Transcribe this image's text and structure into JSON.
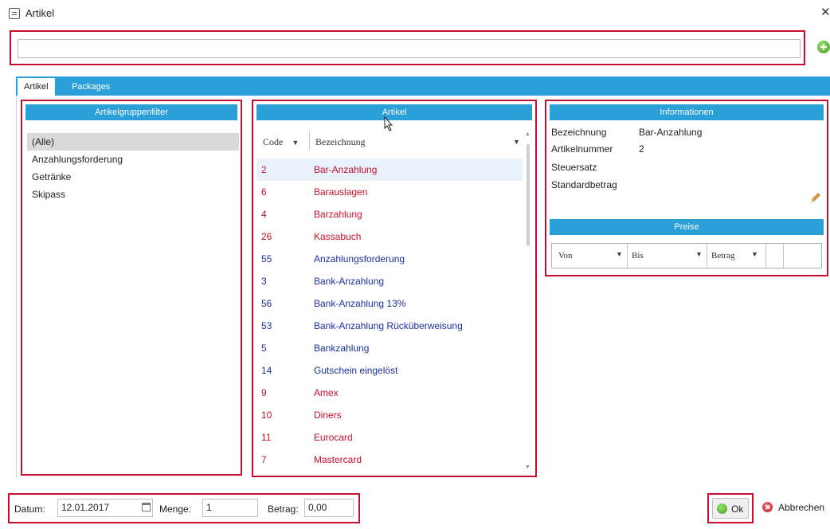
{
  "window": {
    "title": "Artikel",
    "close_symbol": "✕"
  },
  "search": {
    "value": "",
    "placeholder": ""
  },
  "tabs": [
    {
      "label": "Artikel",
      "active": true
    },
    {
      "label": "Packages",
      "active": false
    }
  ],
  "group_panel": {
    "header": "Artikelgruppenfilter",
    "items": [
      {
        "label": "(Alle)",
        "selected": true
      },
      {
        "label": "Anzahlungsforderung",
        "selected": false
      },
      {
        "label": "Getränke",
        "selected": false
      },
      {
        "label": "Skipass",
        "selected": false
      }
    ]
  },
  "artikel_panel": {
    "header": "Artikel",
    "columns": {
      "code": "Code",
      "bezeichnung": "Bezeichnung"
    },
    "rows": [
      {
        "code": "2",
        "bezeichnung": "Bar-Anzahlung",
        "color": "red",
        "selected": true
      },
      {
        "code": "6",
        "bezeichnung": "Barauslagen",
        "color": "red"
      },
      {
        "code": "4",
        "bezeichnung": "Barzahlung",
        "color": "red"
      },
      {
        "code": "26",
        "bezeichnung": "Kassabuch",
        "color": "red"
      },
      {
        "code": "55",
        "bezeichnung": "Anzahlungsforderung",
        "color": "blue"
      },
      {
        "code": "3",
        "bezeichnung": "Bank-Anzahlung",
        "color": "blue"
      },
      {
        "code": "56",
        "bezeichnung": "Bank-Anzahlung 13%",
        "color": "blue"
      },
      {
        "code": "53",
        "bezeichnung": "Bank-Anzahlung Rücküberweisung",
        "color": "blue"
      },
      {
        "code": "5",
        "bezeichnung": "Bankzahlung",
        "color": "blue"
      },
      {
        "code": "14",
        "bezeichnung": "Gutschein eingelöst",
        "color": "blue"
      },
      {
        "code": "9",
        "bezeichnung": "Amex",
        "color": "red"
      },
      {
        "code": "10",
        "bezeichnung": "Diners",
        "color": "red"
      },
      {
        "code": "11",
        "bezeichnung": "Eurocard",
        "color": "red"
      },
      {
        "code": "7",
        "bezeichnung": "Mastercard",
        "color": "red"
      }
    ]
  },
  "info_panel": {
    "header": "Informationen",
    "fields": [
      {
        "label": "Bezeichnung",
        "value": "Bar-Anzahlung"
      },
      {
        "label": "Artikelnummer",
        "value": "2"
      },
      {
        "label": "Steuersatz",
        "value": ""
      },
      {
        "label": "Standardbetrag",
        "value": ""
      }
    ],
    "preise_header": "Preise",
    "preise_columns": {
      "von": "Von",
      "bis": "Bis",
      "betrag": "Betrag"
    }
  },
  "footer": {
    "datum_label": "Datum:",
    "datum_value": "12.01.2017",
    "menge_label": "Menge:",
    "menge_value": "1",
    "betrag_label": "Betrag:",
    "betrag_value": "0,00",
    "ok_label": "Ok",
    "cancel_label": "Abbrechen"
  },
  "colors": {
    "accent": "#2a9fd8",
    "highlight_frame": "#c8102e",
    "red_item": "#c8102e",
    "blue_item": "#1d2f9e"
  }
}
